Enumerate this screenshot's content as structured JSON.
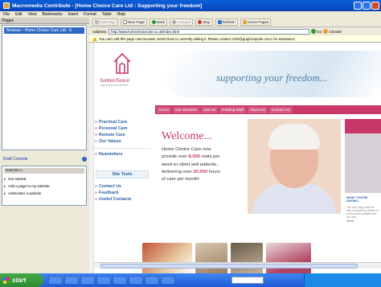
{
  "window": {
    "title": "Macromedia Contribute - [Home Choice Care Ltd : Supporting your freedom]"
  },
  "menu": [
    "File",
    "Edit",
    "View",
    "Bookmarks",
    "Insert",
    "Format",
    "Table",
    "Help"
  ],
  "left_panel": {
    "pages_label": "Pages",
    "browser_item": "Browser - Home Choice Care Ltd : S",
    "drafts_label": "Draft Console",
    "howdo_label": "How Do I...",
    "howdo_items": [
      "Get started",
      "Add a page to my website",
      "Administer a website"
    ]
  },
  "toolbar": {
    "edit_page": "Edit Page",
    "new_page": "New Page",
    "back": "Back",
    "forward": "Forward",
    "stop": "Stop",
    "refresh": "Refresh",
    "home": "Home Pages"
  },
  "address": {
    "label": "Address:",
    "url": "http://www.homechoicecare.co.uk/index.html",
    "go": "Go",
    "choose": "Choose"
  },
  "infobar": {
    "message": "You can't edit this page now because Justin Ross is currently editing it. Please contact <info@graphicspoke.com> for assistance"
  },
  "site": {
    "logo_name": "homechoice",
    "logo_sub": "supporting your freedom",
    "tagline": "supporting your freedom...",
    "nav": [
      "Home",
      "Our Services",
      "Join Us",
      "Existing Staff",
      "About Us",
      "Contact Us"
    ],
    "sidenav_top": [
      "Practical Care",
      "Personal Care",
      "Remote Care",
      "Our Values"
    ],
    "sidenav_mid": [
      "Newsletters"
    ],
    "site_tools": "Site Tools",
    "sidenav_bottom": [
      "Contact Us",
      "Feedback",
      "Useful Contacts"
    ],
    "welcome_heading": "Welcome...",
    "welcome_text": {
      "line1": "Home Choice Care now",
      "line2a": "provide over ",
      "visits": "8,000",
      "line2b": " visits per",
      "line3": "week to client and patients,",
      "line4a": "delivering over ",
      "hours": "20,000",
      "line4b": " hours",
      "line5": "of care per month!"
    },
    "right": {
      "heading": "WHAT YOU'RE SAYING...",
      "snippet": "I am very happy with the help & support my Mother is receiving and pleased with the care...",
      "more": "Tell all"
    }
  },
  "colors": {
    "brand": "#c73868",
    "nav_link": "#2a62a8",
    "tagline": "#4d7fa8"
  }
}
